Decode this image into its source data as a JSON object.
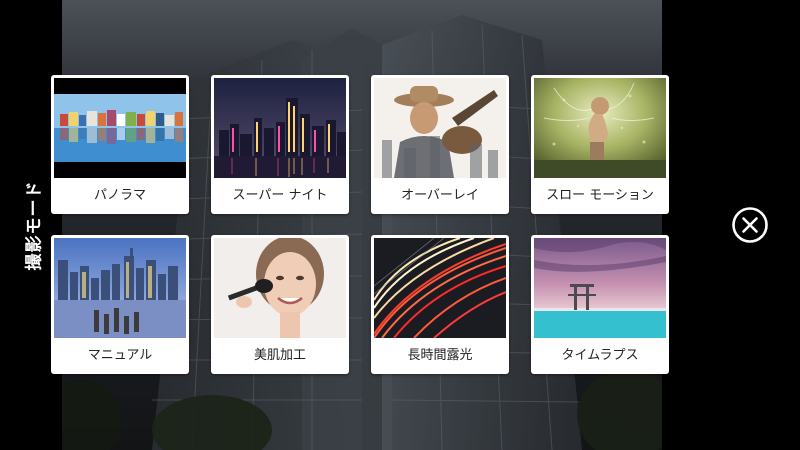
{
  "screen": {
    "title": "撮影モード"
  },
  "modes": [
    {
      "label": "パノラマ",
      "icon": "panorama-thumbnail"
    },
    {
      "label": "スーパー ナイト",
      "icon": "super-night-thumbnail"
    },
    {
      "label": "オーバーレイ",
      "icon": "overlay-thumbnail"
    },
    {
      "label": "スロー モーション",
      "icon": "slow-motion-thumbnail"
    },
    {
      "label": "マニュアル",
      "icon": "manual-thumbnail"
    },
    {
      "label": "美肌加工",
      "icon": "beauty-thumbnail"
    },
    {
      "label": "長時間露光",
      "icon": "long-exposure-thumbnail"
    },
    {
      "label": "タイムラプス",
      "icon": "timelapse-thumbnail"
    }
  ],
  "close": {
    "icon": "close-icon"
  }
}
